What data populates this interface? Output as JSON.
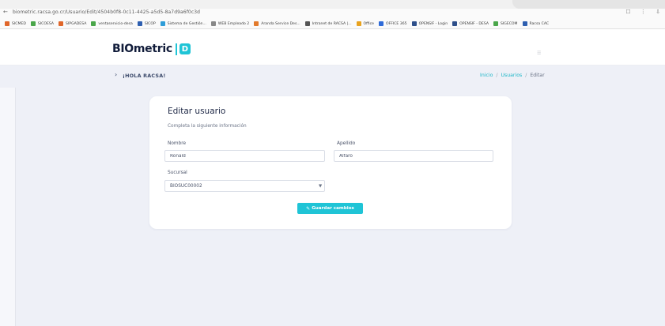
{
  "browser": {
    "url": "biometric.racsa.go.cr/Usuario/Edit/4504b0f8-0c11-4425-a5d5-8a7d9a6f0c3d",
    "bookmarks": [
      {
        "label": "SICMED",
        "color": "#e0662a"
      },
      {
        "label": "SICOESA",
        "color": "#4aa64a"
      },
      {
        "label": "SIPGADESA",
        "color": "#e0662a"
      },
      {
        "label": "ventaservicio-desa",
        "color": "#4aa64a"
      },
      {
        "label": "SICOP",
        "color": "#2e5fb0"
      },
      {
        "label": "Sistema de Gestión...",
        "color": "#2f9dd8"
      },
      {
        "label": "WEB Empleado 2",
        "color": "#888888"
      },
      {
        "label": "Aranda Service Des...",
        "color": "#e27a2c"
      },
      {
        "label": "Intranet de RACSA |...",
        "color": "#555555"
      },
      {
        "label": "Office",
        "color": "#e8a21e"
      },
      {
        "label": "OFFICE 365",
        "color": "#2f6bd8"
      },
      {
        "label": "OPENSIF - Login",
        "color": "#2e4f8a"
      },
      {
        "label": "OPENSIF - DESA",
        "color": "#2e4f8a"
      },
      {
        "label": "SIGECOM",
        "color": "#4aa64a"
      },
      {
        "label": "Racsa CAC",
        "color": "#2e5fb0"
      }
    ]
  },
  "navbar": {
    "logo_text": "BIOmetric",
    "logo_mark": "D"
  },
  "header": {
    "greeting": "¡HOLA RACSA!",
    "breadcrumb": {
      "home": "Inicio",
      "section": "Usuarios",
      "current": "Editar"
    }
  },
  "form": {
    "title": "Editar usuario",
    "subtitle": "Completa la siguiente información",
    "nombre_label": "Nombre",
    "nombre_value": "Ronald",
    "apellido_label": "Apellido",
    "apellido_value": "Alfaro",
    "sucursal_label": "Sucursal",
    "sucursal_value": "BIOSUC00002",
    "save_label": "Guardar cambios"
  },
  "colors": {
    "accent": "#1fc4d6",
    "brand_dark": "#111c3a",
    "background": "#eef0f7"
  }
}
